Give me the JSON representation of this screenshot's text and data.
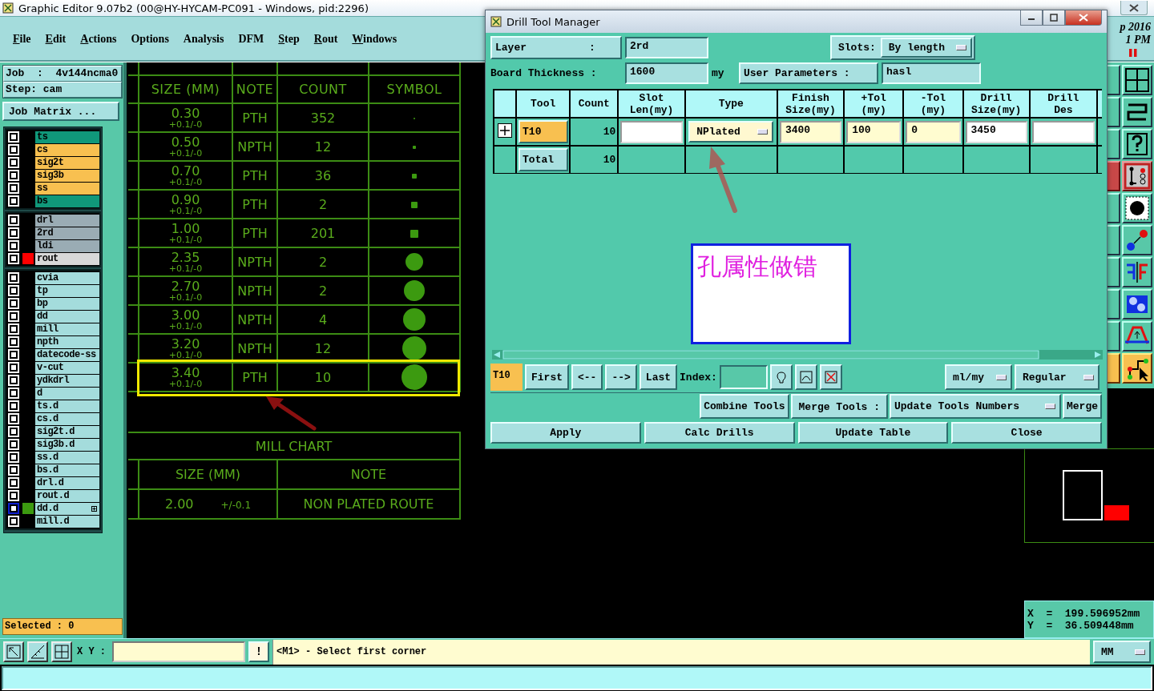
{
  "window": {
    "title": "Graphic Editor 9.07b2 (00@HY-HYCAM-PC091 - Windows, pid:2296)"
  },
  "menu": [
    {
      "label": "File",
      "underlined": true
    },
    {
      "label": "Edit",
      "underlined": true
    },
    {
      "label": "Actions",
      "underlined": true
    },
    {
      "label": "Options",
      "underlined": false
    },
    {
      "label": "Analysis",
      "underlined": false
    },
    {
      "label": "DFM",
      "underlined": false
    },
    {
      "label": "Step",
      "underlined": true
    },
    {
      "label": "Rout",
      "underlined": true
    },
    {
      "label": "Windows",
      "underlined": true
    }
  ],
  "clock": {
    "date": "p 2016",
    "time": "1 PM"
  },
  "job_panel": {
    "job": "Job  :  4v144ncma0",
    "step": "Step: cam",
    "matrix_button": "Job Matrix ...",
    "layer_groups": [
      [
        {
          "name": "ts",
          "color": "#10987a",
          "checked": false,
          "focused": false
        },
        {
          "name": "cs",
          "color": "#f8c050",
          "checked": false,
          "focused": false
        },
        {
          "name": "sig2t",
          "color": "#f8c050",
          "checked": false,
          "focused": false
        },
        {
          "name": "sig3b",
          "color": "#f8c050",
          "checked": false,
          "focused": false
        },
        {
          "name": "ss",
          "color": "#f8c050",
          "checked": false,
          "focused": false
        },
        {
          "name": "bs",
          "color": "#10987a",
          "checked": false,
          "focused": false
        }
      ],
      [
        {
          "name": "drl",
          "color": "#9aacb4",
          "checked": false,
          "focused": false
        },
        {
          "name": "2rd",
          "color": "#9aacb4",
          "checked": false,
          "focused": false
        },
        {
          "name": "ldi",
          "color": "#9aacb4",
          "checked": false,
          "focused": false
        },
        {
          "name": "rout",
          "color": "#d8d8d8",
          "marker": {
            "color": "#ff0000"
          },
          "checked": false,
          "focused": false
        }
      ],
      [
        {
          "name": "cvia",
          "color": "#a4dcdc",
          "checked": false,
          "focused": false
        },
        {
          "name": "tp",
          "color": "#a4dcdc",
          "checked": false,
          "focused": false
        },
        {
          "name": "bp",
          "color": "#a4dcdc",
          "checked": false,
          "focused": false
        },
        {
          "name": "dd",
          "color": "#a4dcdc",
          "checked": false,
          "focused": false
        },
        {
          "name": "mill",
          "color": "#a4dcdc",
          "checked": false,
          "focused": false
        },
        {
          "name": "npth",
          "color": "#a4dcdc",
          "checked": false,
          "focused": false
        },
        {
          "name": "datecode-ss",
          "color": "#a4dcdc",
          "checked": false,
          "focused": false
        },
        {
          "name": "v-cut",
          "color": "#a4dcdc",
          "checked": false,
          "focused": false
        },
        {
          "name": "ydkdrl",
          "color": "#a4dcdc",
          "checked": false,
          "focused": false
        },
        {
          "name": "d",
          "color": "#a4dcdc",
          "checked": false,
          "focused": false
        },
        {
          "name": "ts.d",
          "color": "#a4dcdc",
          "checked": false,
          "focused": false
        },
        {
          "name": "cs.d",
          "color": "#a4dcdc",
          "checked": false,
          "focused": false
        },
        {
          "name": "sig2t.d",
          "color": "#a4dcdc",
          "checked": false,
          "focused": false
        },
        {
          "name": "sig3b.d",
          "color": "#a4dcdc",
          "checked": false,
          "focused": false
        },
        {
          "name": "ss.d",
          "color": "#a4dcdc",
          "checked": false,
          "focused": false
        },
        {
          "name": "bs.d",
          "color": "#a4dcdc",
          "checked": false,
          "focused": false
        },
        {
          "name": "drl.d",
          "color": "#a4dcdc",
          "checked": false,
          "focused": false
        },
        {
          "name": "rout.d",
          "color": "#a4dcdc",
          "checked": false,
          "focused": false
        },
        {
          "name": "dd.d",
          "color": "#a4dcdc",
          "marker": {
            "color": "#3c9a10"
          },
          "expandable": true,
          "checked": false,
          "focused": true
        },
        {
          "name": "mill.d",
          "color": "#a4dcdc",
          "checked": false,
          "focused": false
        }
      ]
    ],
    "selected_count": "Selected : 0"
  },
  "drill_chart": {
    "columns": [
      "SIZE (MM)",
      "NOTE",
      "COUNT",
      "SYMBOL"
    ],
    "rows": [
      {
        "size": "0.30",
        "tolerance": "+0.1/-0",
        "note": "PTH",
        "count": "352",
        "selected": false
      },
      {
        "size": "0.50",
        "tolerance": "+0.1/-0",
        "note": "NPTH",
        "count": "12",
        "selected": false
      },
      {
        "size": "0.70",
        "tolerance": "+0.1/-0",
        "note": "PTH",
        "count": "36",
        "selected": false
      },
      {
        "size": "0.90",
        "tolerance": "+0.1/-0",
        "note": "PTH",
        "count": "2",
        "selected": false
      },
      {
        "size": "1.00",
        "tolerance": "+0.1/-0",
        "note": "PTH",
        "count": "201",
        "selected": false
      },
      {
        "size": "2.35",
        "tolerance": "+0.1/-0",
        "note": "NPTH",
        "count": "2",
        "selected": false
      },
      {
        "size": "2.70",
        "tolerance": "+0.1/-0",
        "note": "NPTH",
        "count": "2",
        "selected": false
      },
      {
        "size": "3.00",
        "tolerance": "+0.1/-0",
        "note": "NPTH",
        "count": "4",
        "selected": false
      },
      {
        "size": "3.20",
        "tolerance": "+0.1/-0",
        "note": "NPTH",
        "count": "12",
        "selected": false
      },
      {
        "size": "3.40",
        "tolerance": "+0.1/-0",
        "note": "PTH",
        "count": "10",
        "selected": true
      }
    ]
  },
  "mill_chart": {
    "title": "MILL CHART",
    "columns": [
      "SIZE (MM)",
      "NOTE"
    ],
    "rows": [
      {
        "size": "2.00",
        "tolerance": "+/-0.1",
        "note": "NON PLATED ROUTE"
      }
    ]
  },
  "dialog": {
    "title": "Drill Tool Manager",
    "layer_label": "Layer          :",
    "layer": "2rd",
    "slots_label": "Slots:",
    "slots": "By length",
    "thickness_label": "Board Thickness :",
    "thickness": "1600",
    "thickness_unit": "my",
    "user_params_button": "User Parameters :",
    "user_params": "hasl",
    "columns": [
      "Tool",
      "Count",
      "Slot\nLen(my)",
      "Type",
      "Finish\nSize(my)",
      "+Tol\n(my)",
      "-Tol\n(my)",
      "Drill\nSize(my)",
      "Drill\nDes"
    ],
    "tools": [
      {
        "tool": "T10",
        "count": "10",
        "type": "NPlated",
        "finish_size": "3400",
        "plus_tol": "100",
        "minus_tol": "0",
        "drill_size": "3450",
        "selected": true
      }
    ],
    "total": {
      "label": "Total",
      "count": "10"
    },
    "current_tool": "T10",
    "nav_buttons": [
      "First",
      "<--",
      "-->",
      "Last"
    ],
    "index_label": "Index:",
    "units": "ml/my",
    "mode": "Regular",
    "combine_button": "Combine Tools",
    "merge_label": "Merge Tools :",
    "merge_mode": "Update Tools Numbers",
    "merge_button": "Merge",
    "actions": [
      "Apply",
      "Calc Drills",
      "Update Table",
      "Close"
    ]
  },
  "annotation": {
    "text": "孔属性做错"
  },
  "coordinates": {
    "x": "X  =  199.596952mm",
    "y": "Y  =  36.509448mm"
  },
  "command_bar": {
    "xy_label": "X Y :",
    "alert_button": "!",
    "message": "<M1> - Select first corner",
    "units": "MM"
  }
}
